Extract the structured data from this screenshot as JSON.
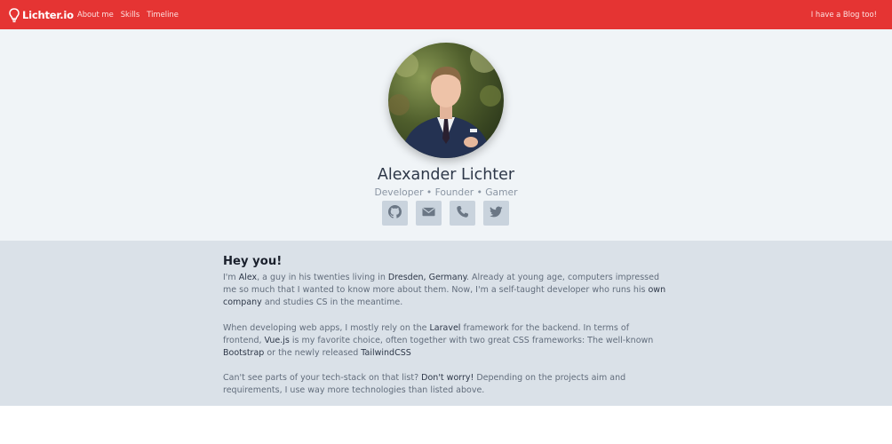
{
  "nav": {
    "brand": "Lichter.io",
    "links": [
      "About me",
      "Skills",
      "Timeline"
    ],
    "right_link": "I have a Blog too!"
  },
  "hero": {
    "name": "Alexander Lichter",
    "tagline": "Developer • Founder • Gamer",
    "socials": [
      "github-icon",
      "envelope-icon",
      "phone-icon",
      "twitter-icon"
    ]
  },
  "about": {
    "title": "Hey you!",
    "p1": {
      "t1": "I'm ",
      "h1": "Alex",
      "t2": ", a guy in his twenties living in ",
      "h2": "Dresden, Germany",
      "t3": ". Already at young age, computers impressed me so much that I wanted to know more about them. Now, I'm a self-taught developer who runs his ",
      "h3": "own company",
      "t4": " and studies CS in the meantime."
    },
    "p2": {
      "t1": "When developing web apps, I mostly rely on the ",
      "h1": "Laravel",
      "t2": " framework for the backend. In terms of frontend, ",
      "h2": "Vue.js",
      "t3": " is my favorite choice, often together with two great CSS frameworks: The well-known ",
      "h3": "Bootstrap",
      "t4": " or the newly released ",
      "h4": "TailwindCSS"
    },
    "p3": {
      "t1": "Can't see parts of your tech-stack on that list? ",
      "h1": "Don't worry!",
      "t2": " Depending on the projects aim and requirements, I use way more technologies than listed above."
    }
  },
  "colors": {
    "navbar": "#e53433",
    "hero_bg": "#f0f4f7",
    "about_bg": "#dae1e8",
    "social_btn": "#c9d3dd"
  }
}
